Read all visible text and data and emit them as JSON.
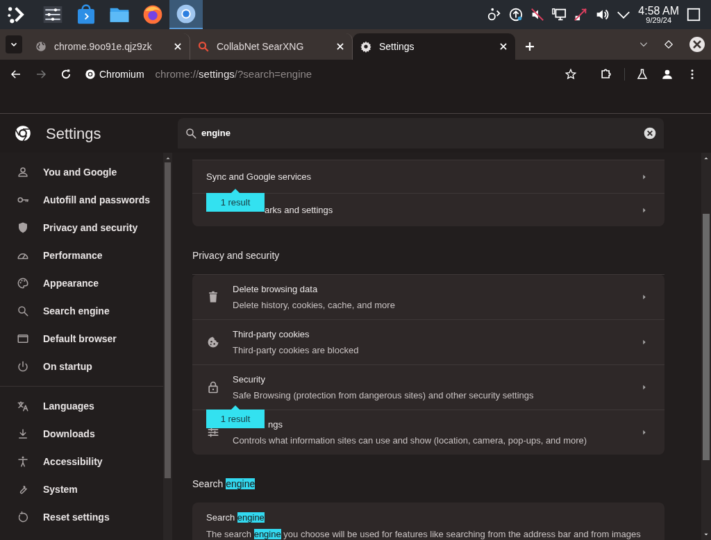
{
  "taskbar": {
    "apps": [
      {
        "selected": false
      },
      {
        "selected": false
      },
      {
        "selected": false
      },
      {
        "selected": false
      },
      {
        "selected": false
      },
      {
        "selected": true
      }
    ],
    "time": "4:58 AM",
    "date": "9/29/24"
  },
  "tabs": [
    {
      "title": "chrome.9oo91e.qjz9zk",
      "selected": false
    },
    {
      "title": "CollabNet SearXNG",
      "selected": false
    },
    {
      "title": "Settings",
      "selected": true
    }
  ],
  "toolbar": {
    "site_label": "Chromium",
    "url_dim_prefix": "chrome://",
    "url_host": "settings",
    "url_rest": "/?search=engine"
  },
  "settings": {
    "title": "Settings",
    "search": {
      "value": "engine"
    },
    "sidebar": {
      "groups": [
        [
          {
            "label": "You and Google"
          },
          {
            "label": "Autofill and passwords"
          },
          {
            "label": "Privacy and security"
          },
          {
            "label": "Performance"
          },
          {
            "label": "Appearance"
          },
          {
            "label": "Search engine"
          },
          {
            "label": "Default browser"
          },
          {
            "label": "On startup"
          }
        ],
        [
          {
            "label": "Languages"
          },
          {
            "label": "Downloads"
          },
          {
            "label": "Accessibility"
          },
          {
            "label": "System"
          },
          {
            "label": "Reset settings"
          }
        ]
      ]
    },
    "sections": [
      {
        "rows": [
          {
            "title": "Sync and Google services"
          },
          {
            "title": "arks and settings",
            "bubble": "1 result"
          }
        ]
      },
      {
        "heading": [
          {
            "text": "Privacy and security",
            "highlight": false
          }
        ],
        "rows": [
          {
            "title": "Delete browsing data",
            "subtitle": "Delete history, cookies, cache, and more"
          },
          {
            "title": "Third-party cookies",
            "subtitle": "Third-party cookies are blocked"
          },
          {
            "title": "Security",
            "subtitle": "Safe Browsing (protection from dangerous sites) and other security settings"
          },
          {
            "title": "ngs",
            "subtitle": "Controls what information sites can use and show (location, camera, pop-ups, and more)",
            "bubble": "1 result"
          }
        ]
      },
      {
        "heading": [
          {
            "text": "Search ",
            "highlight": false
          },
          {
            "text": "engine",
            "highlight": true
          }
        ],
        "text_rows": [
          {
            "title": [
              {
                "text": "Search ",
                "highlight": false
              },
              {
                "text": "engine",
                "highlight": true
              }
            ],
            "subtitle": [
              {
                "text": "The search ",
                "highlight": false
              },
              {
                "text": "engine",
                "highlight": true
              },
              {
                "text": " you choose will be used for features like searching from the address bar and from images",
                "highlight": false
              }
            ]
          }
        ]
      }
    ]
  }
}
